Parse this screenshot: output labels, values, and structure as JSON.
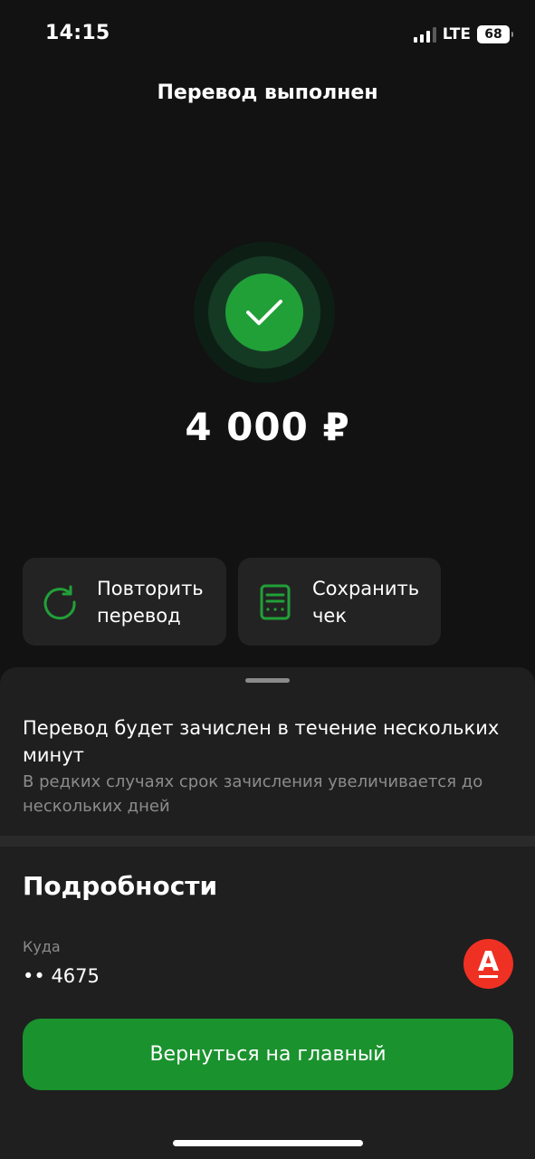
{
  "status_bar": {
    "time": "14:15",
    "network": "LTE",
    "battery": "68"
  },
  "header": {
    "title": "Перевод выполнен"
  },
  "success": {
    "icon": "checkmark-icon",
    "color": "#21a038"
  },
  "amount": "4 000 ₽",
  "actions": [
    {
      "label": "Повторить перевод",
      "icon": "repeat-icon"
    },
    {
      "label": "Сохранить чек",
      "icon": "receipt-icon"
    }
  ],
  "notice": {
    "title": "Перевод будет зачислен в течение нескольких минут",
    "text": "В редких случаях срок зачисления увеличивается до нескольких дней"
  },
  "details": {
    "heading": "Подробности",
    "destination_label": "Куда",
    "destination_value": "•• 4675",
    "bank_logo_letter": "А"
  },
  "primary_button": {
    "label": "Вернуться на главный",
    "color": "#1a922e"
  }
}
